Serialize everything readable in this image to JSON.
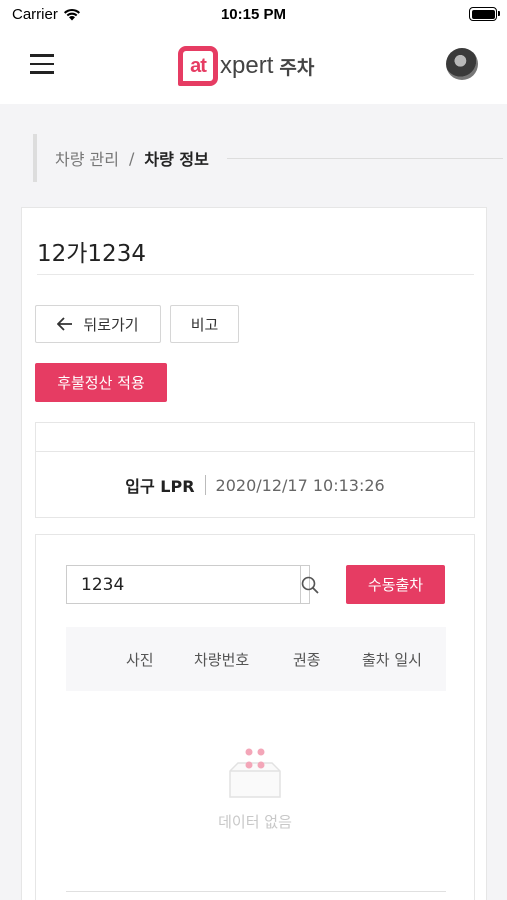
{
  "status_bar": {
    "carrier": "Carrier",
    "time": "10:15 PM"
  },
  "app_bar": {
    "logo_mark": "at",
    "logo_text": "xpert",
    "logo_suffix": "주차",
    "brand_color": "#e63c63"
  },
  "breadcrumb": {
    "parent": "차량 관리",
    "separator": "/",
    "current": "차량 정보"
  },
  "vehicle": {
    "plate": "12가1234"
  },
  "buttons": {
    "back": "뒤로가기",
    "note": "비고",
    "postpay": "후불정산 적용",
    "manual_exit": "수동출차"
  },
  "lpr": {
    "label": "입구 LPR",
    "timestamp": "2020/12/17 10:13:26"
  },
  "search": {
    "value": "1234"
  },
  "table": {
    "columns": [
      "사진",
      "차량번호",
      "권종",
      "출차 일시"
    ],
    "empty_text": "데이터 없음"
  },
  "icons": {
    "menu": "hamburger-icon",
    "back": "arrow-left-icon",
    "search": "search-icon",
    "empty": "empty-inbox-icon"
  }
}
